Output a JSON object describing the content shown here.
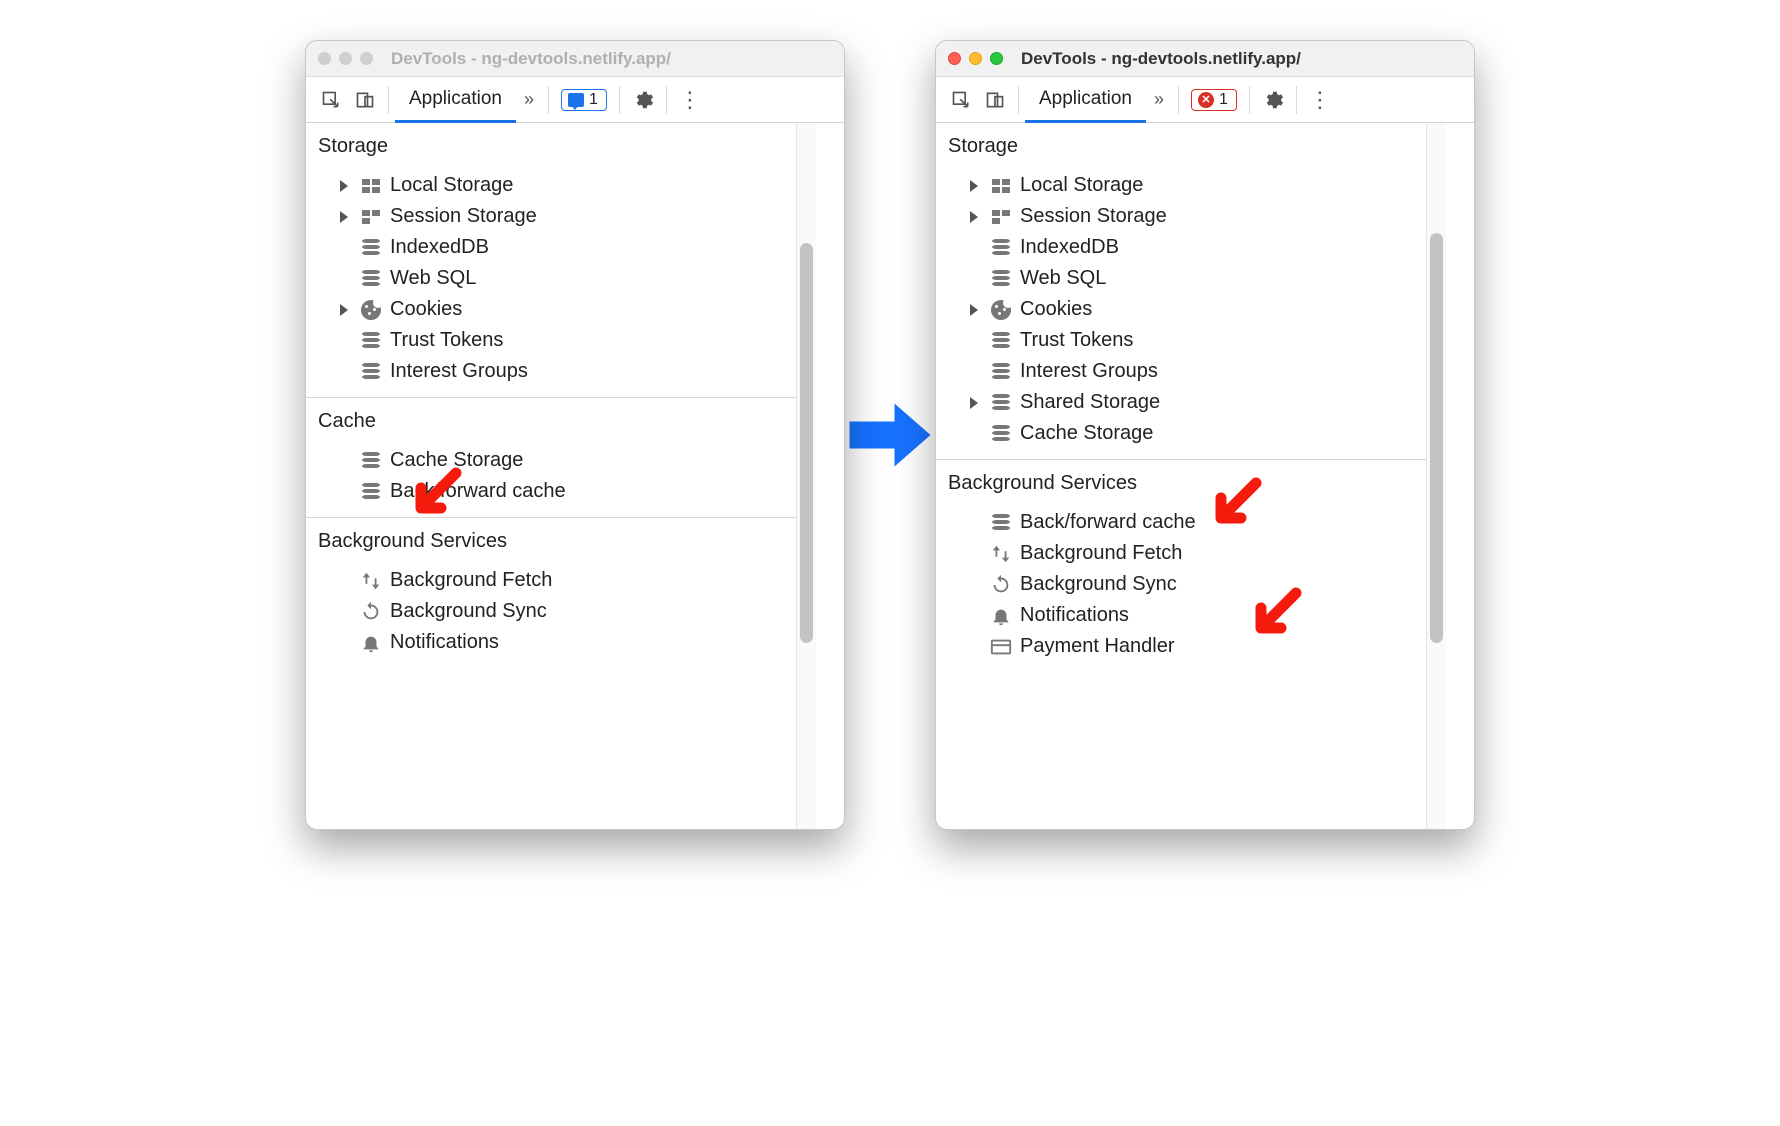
{
  "left": {
    "active": false,
    "title": "DevTools - ng-devtools.netlify.app/",
    "toolbar": {
      "tab": "Application",
      "badge_count": "1",
      "badge_type": "message"
    },
    "sections": [
      {
        "title": "Storage",
        "items": [
          {
            "label": "Local Storage",
            "icon": "grid4",
            "expandable": true
          },
          {
            "label": "Session Storage",
            "icon": "grid4b",
            "expandable": true
          },
          {
            "label": "IndexedDB",
            "icon": "db",
            "expandable": false
          },
          {
            "label": "Web SQL",
            "icon": "db",
            "expandable": false
          },
          {
            "label": "Cookies",
            "icon": "cookie",
            "expandable": true
          },
          {
            "label": "Trust Tokens",
            "icon": "db",
            "expandable": false
          },
          {
            "label": "Interest Groups",
            "icon": "db",
            "expandable": false
          }
        ]
      },
      {
        "title": "Cache",
        "items": [
          {
            "label": "Cache Storage",
            "icon": "db",
            "expandable": false
          },
          {
            "label": "Back/forward cache",
            "icon": "db",
            "expandable": false
          }
        ]
      },
      {
        "title": "Background Services",
        "items": [
          {
            "label": "Background Fetch",
            "icon": "updown",
            "expandable": false
          },
          {
            "label": "Background Sync",
            "icon": "sync",
            "expandable": false
          },
          {
            "label": "Notifications",
            "icon": "bell",
            "expandable": false
          }
        ]
      }
    ]
  },
  "right": {
    "active": true,
    "title": "DevTools - ng-devtools.netlify.app/",
    "toolbar": {
      "tab": "Application",
      "badge_count": "1",
      "badge_type": "error"
    },
    "sections": [
      {
        "title": "Storage",
        "items": [
          {
            "label": "Local Storage",
            "icon": "grid4",
            "expandable": true
          },
          {
            "label": "Session Storage",
            "icon": "grid4b",
            "expandable": true
          },
          {
            "label": "IndexedDB",
            "icon": "db",
            "expandable": false
          },
          {
            "label": "Web SQL",
            "icon": "db",
            "expandable": false
          },
          {
            "label": "Cookies",
            "icon": "cookie",
            "expandable": true
          },
          {
            "label": "Trust Tokens",
            "icon": "db",
            "expandable": false
          },
          {
            "label": "Interest Groups",
            "icon": "db",
            "expandable": false
          },
          {
            "label": "Shared Storage",
            "icon": "db",
            "expandable": true
          },
          {
            "label": "Cache Storage",
            "icon": "db",
            "expandable": false
          }
        ]
      },
      {
        "title": "Background Services",
        "items": [
          {
            "label": "Back/forward cache",
            "icon": "db",
            "expandable": false
          },
          {
            "label": "Background Fetch",
            "icon": "updown",
            "expandable": false
          },
          {
            "label": "Background Sync",
            "icon": "sync",
            "expandable": false
          },
          {
            "label": "Notifications",
            "icon": "bell",
            "expandable": false
          },
          {
            "label": "Payment Handler",
            "icon": "card",
            "expandable": false
          }
        ]
      }
    ]
  },
  "annotations": {
    "color": "#f41b0c"
  }
}
